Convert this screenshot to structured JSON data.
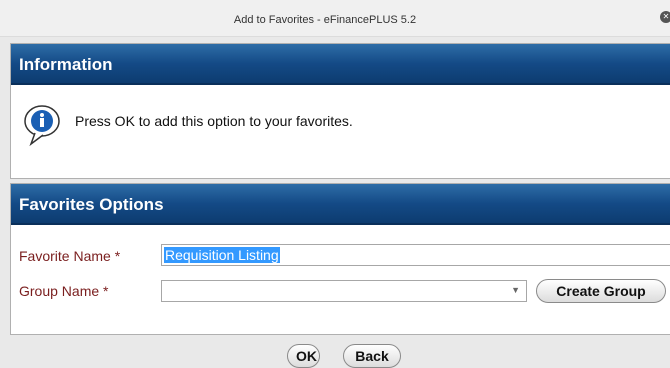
{
  "window": {
    "title": "Add to Favorites - eFinancePLUS 5.2"
  },
  "information": {
    "header": "Information",
    "message": "Press OK to add this option to your favorites."
  },
  "favorites": {
    "header": "Favorites Options",
    "favorite_name_label": "Favorite Name *",
    "favorite_name_value": "Requisition Listing",
    "group_name_label": "Group Name *",
    "group_name_value": "",
    "create_group_label": "Create Group"
  },
  "footer": {
    "ok_label": "OK",
    "back_label": "Back"
  },
  "icons": {
    "info": "info-icon",
    "close": "close-icon",
    "dropdown": "chevron-down-icon"
  },
  "colors": {
    "header_bg": "#144a86",
    "label_text": "#7a1e1e",
    "selection": "#3399ff"
  }
}
